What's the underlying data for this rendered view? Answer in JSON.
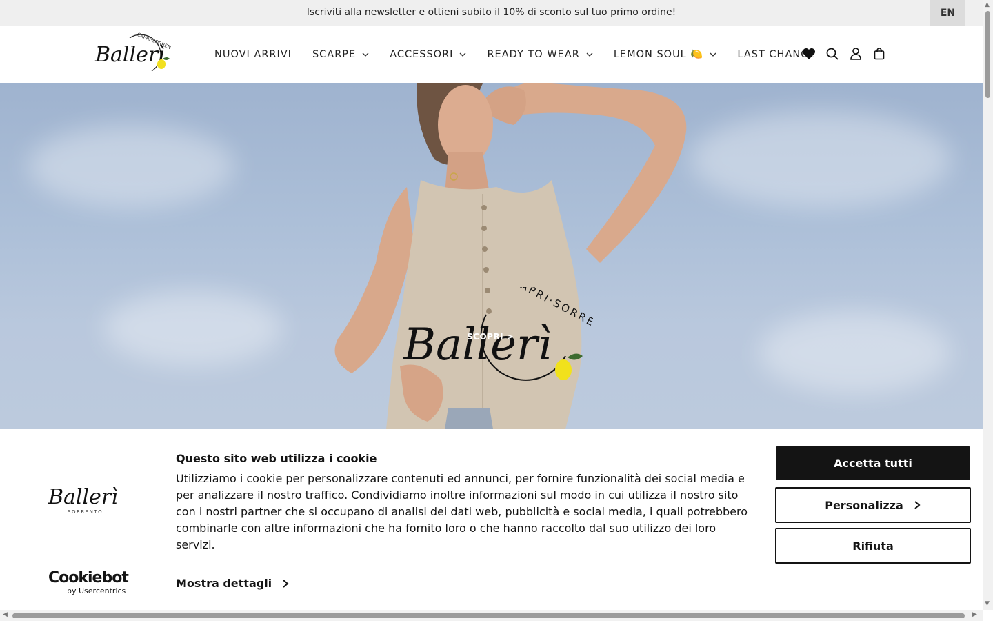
{
  "announcement": {
    "text": "Iscriviti alla newsletter e ottieni subito il 10% di sconto sul tuo primo ordine!",
    "language": "EN"
  },
  "header": {
    "logo": {
      "brand": "Ballerì",
      "tagline": "CAPRI·SORRENTO"
    },
    "nav": [
      {
        "label": "NUOVI ARRIVI",
        "dropdown": false
      },
      {
        "label": "SCARPE",
        "dropdown": true
      },
      {
        "label": "ACCESSORI",
        "dropdown": true
      },
      {
        "label": "READY TO WEAR",
        "dropdown": true
      },
      {
        "label": "LEMON SOUL 🍋",
        "dropdown": true
      },
      {
        "label": "LAST CHANCE",
        "dropdown": false
      }
    ],
    "icons": [
      "heart-icon",
      "search-icon",
      "user-icon",
      "bag-icon"
    ]
  },
  "hero": {
    "logo": {
      "brand": "Ballerì",
      "tagline": "CAPRI·SORRENTO"
    },
    "cta": "SCOPRI >"
  },
  "cookie": {
    "logo": {
      "brand": "Ballerì",
      "tagline": "SORRENTO"
    },
    "title": "Questo sito web utilizza i cookie",
    "body": "Utilizziamo i cookie per personalizzare contenuti ed annunci, per fornire funzionalità dei social media e per analizzare il nostro traffico. Condividiamo inoltre informazioni sul modo in cui utilizza il nostro sito con i nostri partner che si occupano di analisi dei dati web, pubblicità e social media, i quali potrebbero combinarle con altre informazioni che ha fornito loro o che hanno raccolto dal suo utilizzo dei loro servizi.",
    "details": "Mostra dettagli",
    "accept": "Accetta tutti",
    "customize": "Personalizza",
    "reject": "Rifiuta",
    "provider": {
      "name": "Cookiebot",
      "by": "by Usercentrics"
    }
  }
}
